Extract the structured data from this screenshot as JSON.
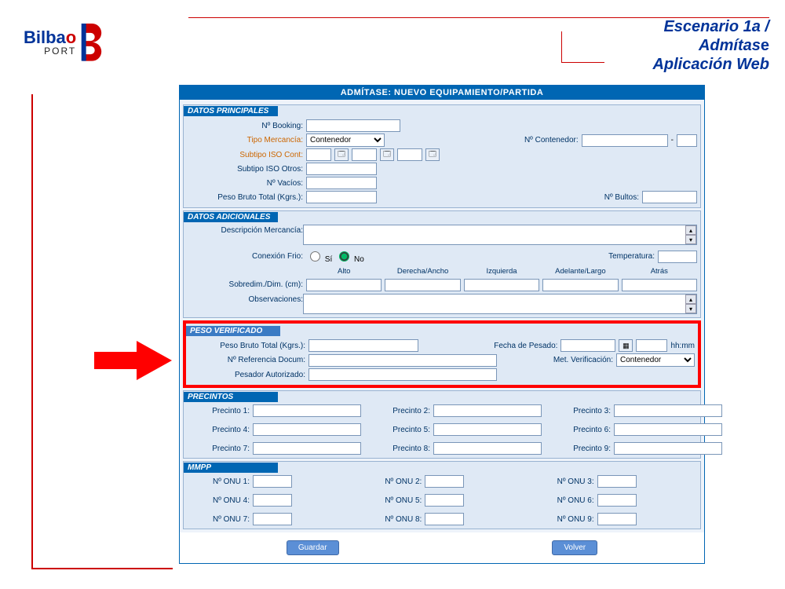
{
  "branding": {
    "bilbao_part1": "Bilba",
    "bilbao_part2": "o",
    "port": "PORT"
  },
  "slide_title": {
    "line1": "Escenario 1a /",
    "line2_em": "Admítas",
    "line2_suffix": "e",
    "line3": "Aplicación Web"
  },
  "app": {
    "header": "ADMÍTASE: NUEVO EQUIPAMIENTO/PARTIDA",
    "sections": {
      "datos_principales": {
        "title": "DATOS PRINCIPALES",
        "n_booking": "Nº Booking:",
        "tipo_mercancia": "Tipo Mercancía:",
        "tipo_mercancia_options": [
          "Contenedor"
        ],
        "n_contenedor": "Nº Contenedor:",
        "subtipo_iso_cont": "Subtipo ISO Cont:",
        "subtipo_iso_otros": "Subtipo ISO Otros:",
        "n_vacios": "Nº Vacíos:",
        "peso_bruto_total": "Peso Bruto Total (Kgrs.):",
        "n_bultos": "Nº Bultos:"
      },
      "datos_adicionales": {
        "title": "DATOS ADICIONALES",
        "descripcion": "Descripción Mercancía:",
        "conexion_frio": "Conexión Frio:",
        "si": "Sí",
        "no": "No",
        "conexion_frio_value": "No",
        "temperatura": "Temperatura:",
        "dim_headers": [
          "Alto",
          "Derecha/Ancho",
          "Izquierda",
          "Adelante/Largo",
          "Atrás"
        ],
        "sobredim": "Sobredim./Dim. (cm):",
        "observaciones": "Observaciones:"
      },
      "peso_verificado": {
        "title": "PESO VERIFICADO",
        "peso_bruto_total": "Peso Bruto Total (Kgrs.):",
        "fecha_pesado": "Fecha de Pesado:",
        "hhmm": "hh:mm",
        "n_referencia": "Nº Referencia Docum:",
        "met_verificacion": "Met. Verificación:",
        "met_options": [
          "Contenedor"
        ],
        "pesador": "Pesador Autorizado:"
      },
      "precintos": {
        "title": "PRECINTOS",
        "labels": [
          "Precinto 1:",
          "Precinto 2:",
          "Precinto 3:",
          "Precinto 4:",
          "Precinto 5:",
          "Precinto 6:",
          "Precinto 7:",
          "Precinto 8:",
          "Precinto 9:"
        ]
      },
      "mmpp": {
        "title": "MMPP",
        "labels": [
          "Nº ONU 1:",
          "Nº ONU 2:",
          "Nº ONU 3:",
          "Nº ONU 4:",
          "Nº ONU 5:",
          "Nº ONU 6:",
          "Nº ONU 7:",
          "Nº ONU 8:",
          "Nº ONU 9:"
        ]
      }
    },
    "buttons": {
      "guardar": "Guardar",
      "volver": "Volver"
    }
  }
}
